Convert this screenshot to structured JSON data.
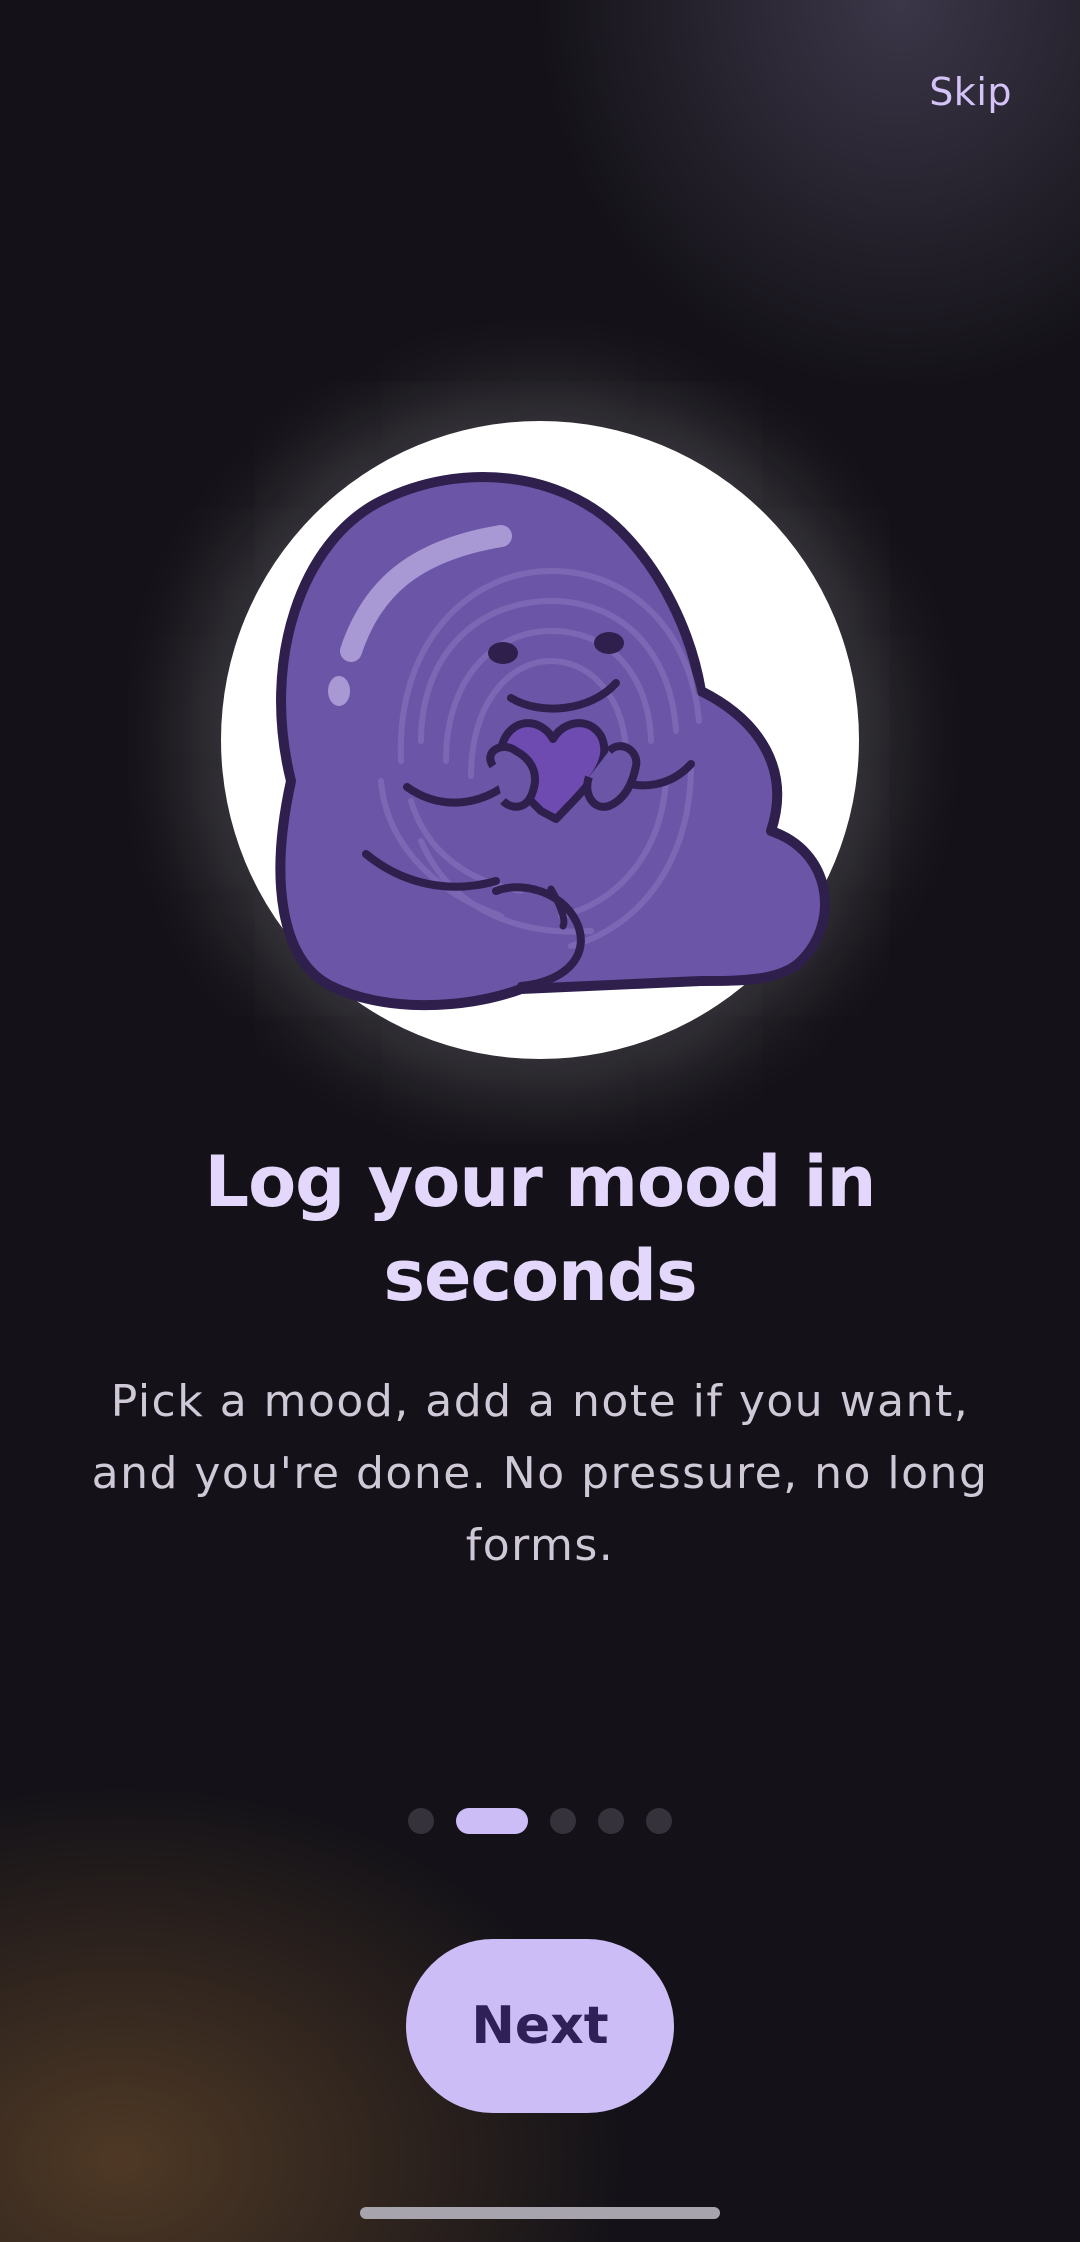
{
  "onboarding": {
    "skip_label": "Skip",
    "headline": "Log your mood in seconds",
    "description": "Pick a mood, add a note if you want, and you're done. No pressure, no long forms.",
    "next_label": "Next",
    "pager": {
      "total_pages": 5,
      "current_page": 2
    },
    "illustration": {
      "subject": "purple-blob-mascot-hugging-heart",
      "colors": {
        "body": "#6b55a6",
        "outline": "#2e1f4d",
        "heart": "#6e4bb0",
        "circle": "#ffffff"
      }
    }
  },
  "theme": {
    "background": "#141218",
    "accent": "#cdbdf7",
    "accent_text": "#2f2158",
    "headline_color": "#e3d8fb",
    "body_color": "#cfc8d6",
    "inactive_dot": "#35323b"
  }
}
